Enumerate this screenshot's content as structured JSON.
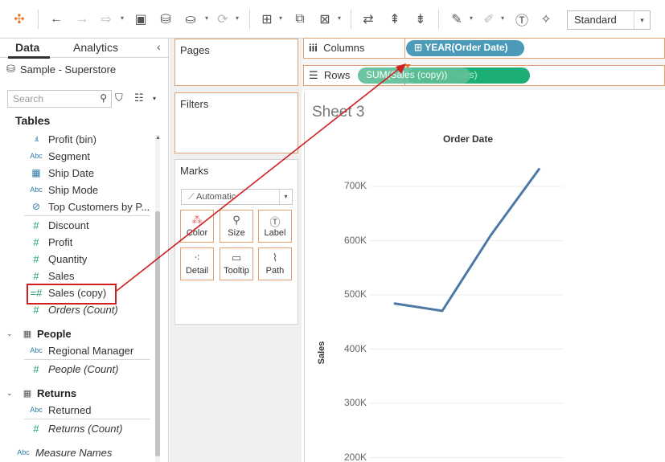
{
  "toolbar": {
    "items": [
      "tableau-logo-icon",
      "undo-icon",
      "redo-icon",
      "redo-dropdown-icon",
      "save-icon",
      "new-datasource-icon",
      "pause-icon",
      "refresh-icon",
      "new-worksheet-icon",
      "duplicate-icon",
      "clear-icon",
      "swap-icon",
      "sort-ascending-icon",
      "sort-descending-icon",
      "highlight-icon",
      "group-icon",
      "label-icon",
      "pin-icon"
    ],
    "fit_select": "Standard"
  },
  "data_pane": {
    "tabs": [
      {
        "label": "Data",
        "active": true
      },
      {
        "label": "Analytics",
        "active": false
      }
    ],
    "datasource": "Sample - Superstore",
    "search_placeholder": "Search",
    "tables_heading": "Tables",
    "fields": [
      {
        "label": "Profit (bin)",
        "icon": "bin-icon",
        "kind": "dimension"
      },
      {
        "label": "Segment",
        "icon": "abc-icon",
        "kind": "dimension"
      },
      {
        "label": "Ship Date",
        "icon": "calendar-icon",
        "kind": "dimension"
      },
      {
        "label": "Ship Mode",
        "icon": "abc-icon",
        "kind": "dimension"
      },
      {
        "label": "Top Customers by P...",
        "icon": "set-icon",
        "kind": "dimension"
      },
      {
        "label": "Discount",
        "icon": "measure-icon",
        "kind": "measure"
      },
      {
        "label": "Profit",
        "icon": "measure-icon",
        "kind": "measure"
      },
      {
        "label": "Quantity",
        "icon": "measure-icon",
        "kind": "measure"
      },
      {
        "label": "Sales",
        "icon": "measure-icon",
        "kind": "measure"
      },
      {
        "label": "Sales (copy)",
        "icon": "calculated-measure-icon",
        "kind": "measure",
        "highlighted": true
      },
      {
        "label": "Orders (Count)",
        "icon": "measure-icon",
        "kind": "measure",
        "italic": true
      }
    ],
    "groups": [
      {
        "label": "People",
        "fields": [
          {
            "label": "Regional Manager",
            "icon": "abc-icon"
          },
          {
            "label": "People (Count)",
            "icon": "measure-icon",
            "italic": true
          }
        ]
      },
      {
        "label": "Returns",
        "fields": [
          {
            "label": "Returned",
            "icon": "abc-icon"
          },
          {
            "label": "Returns (Count)",
            "icon": "measure-icon",
            "italic": true
          }
        ]
      }
    ],
    "bottom_field": {
      "label": "Measure Names",
      "icon": "abc-icon",
      "italic": true
    }
  },
  "cards": {
    "pages": "Pages",
    "filters": "Filters",
    "marks": "Marks",
    "mark_type": "Automatic",
    "mark_buttons": [
      "Color",
      "Size",
      "Label",
      "Detail",
      "Tooltip",
      "Path"
    ]
  },
  "shelves": {
    "columns_label": "Columns",
    "rows_label": "Rows",
    "columns_pill": "YEAR(Order Date)",
    "rows_pill_front": "SUM(Sales (copy))",
    "rows_pill_back": "SUM(Sales)"
  },
  "colors": {
    "accent_orange": "#e3a070",
    "dimension_pill": "#4b9ab8",
    "measure_pill": "#1baf75",
    "line": "#4e79a7",
    "annotation_red": "#d11f1f"
  },
  "chart_data": {
    "type": "line",
    "title": "Sheet 3",
    "column_header": "Order Date",
    "ylabel": "Sales",
    "ylim": [
      200000,
      750000
    ],
    "y_ticks": [
      "700K",
      "600K",
      "500K",
      "400K",
      "300K",
      "200K"
    ],
    "y_tick_values": [
      700000,
      600000,
      500000,
      400000,
      300000,
      200000
    ],
    "series": [
      {
        "values": [
          484247,
          470533,
          609206,
          733215
        ]
      }
    ]
  }
}
